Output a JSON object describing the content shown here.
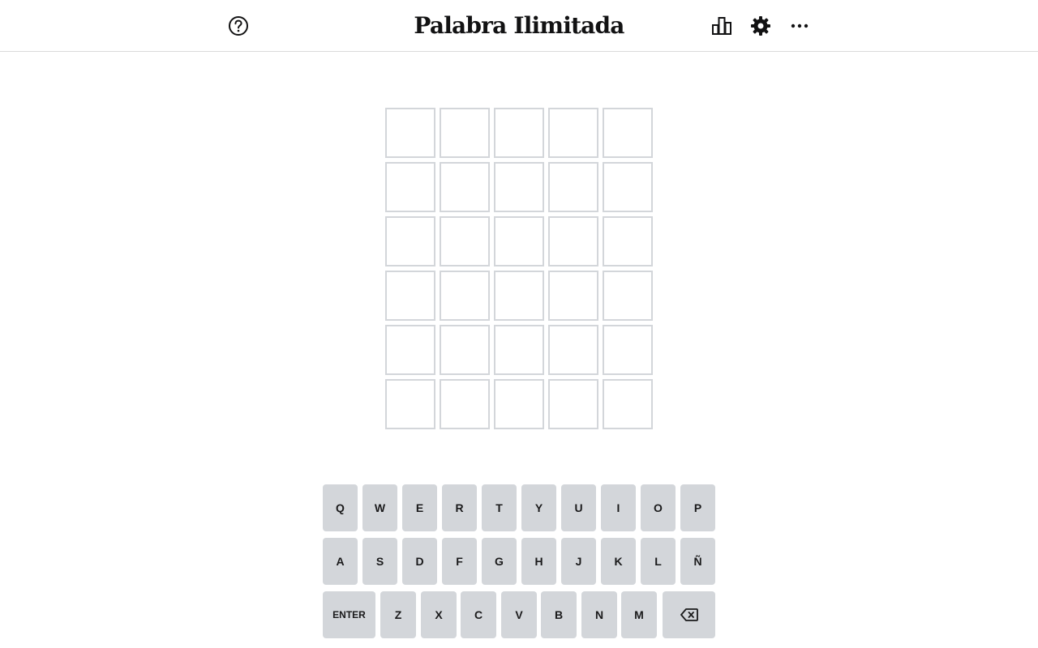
{
  "header": {
    "title": "Palabra Ilimitada",
    "help_icon": "question-circle-icon",
    "stats_icon": "bar-chart-icon",
    "settings_icon": "gear-icon",
    "more_icon": "ellipsis-icon"
  },
  "board": {
    "rows": [
      [
        "",
        "",
        "",
        "",
        ""
      ],
      [
        "",
        "",
        "",
        "",
        ""
      ],
      [
        "",
        "",
        "",
        "",
        ""
      ],
      [
        "",
        "",
        "",
        "",
        ""
      ],
      [
        "",
        "",
        "",
        "",
        ""
      ],
      [
        "",
        "",
        "",
        "",
        ""
      ]
    ]
  },
  "keyboard": {
    "row1": [
      "Q",
      "W",
      "E",
      "R",
      "T",
      "Y",
      "U",
      "I",
      "O",
      "P"
    ],
    "row2": [
      "A",
      "S",
      "D",
      "F",
      "G",
      "H",
      "J",
      "K",
      "L",
      "Ñ"
    ],
    "row3": [
      "ENTER",
      "Z",
      "X",
      "C",
      "V",
      "B",
      "N",
      "M"
    ],
    "backspace_icon": "backspace-icon"
  },
  "colors": {
    "tile_border": "#d3d6da",
    "key_background": "#d3d6da",
    "header_border": "#dadadb",
    "text": "#121213"
  }
}
